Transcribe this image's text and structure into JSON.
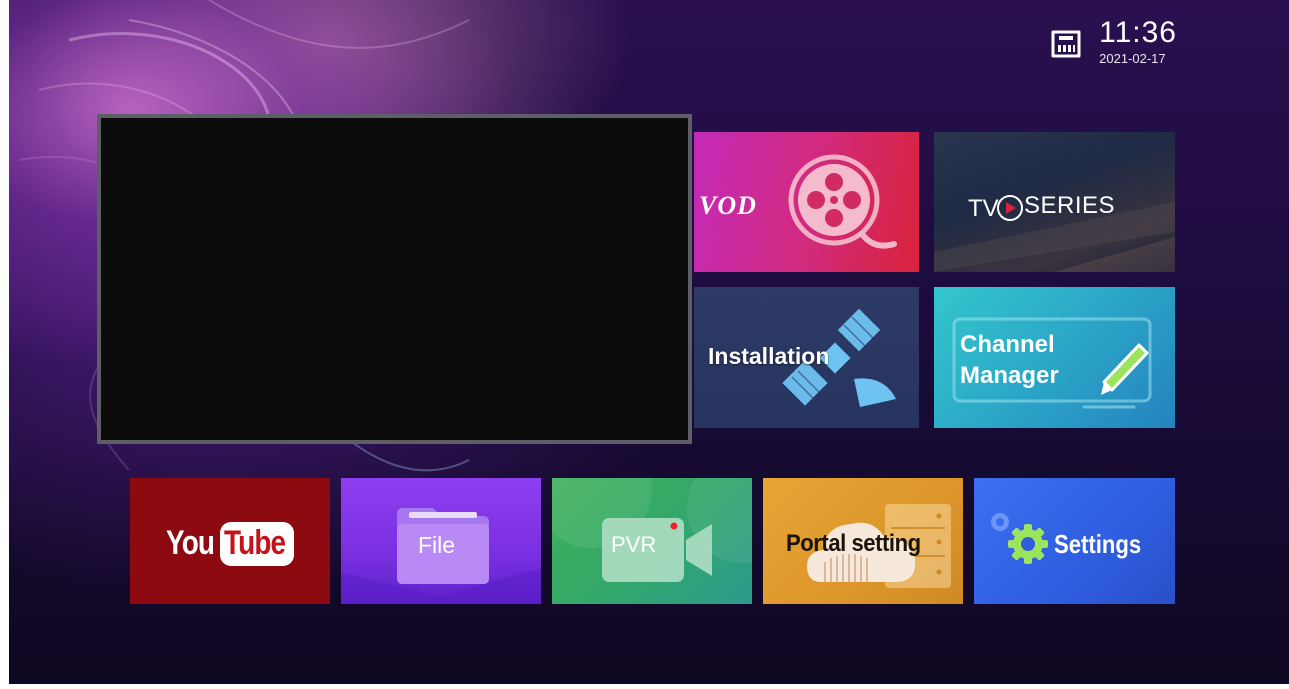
{
  "status": {
    "network_icon": "ethernet-icon",
    "time": "11:36",
    "date": "2021-02-17"
  },
  "preview": {
    "state": "no-signal"
  },
  "tiles": {
    "vod": {
      "label": "VOD",
      "icon": "film-reel-icon"
    },
    "tv_series": {
      "label_prefix": "TV",
      "label": "SERIES",
      "icon": "play-circle-icon"
    },
    "installation": {
      "label": "Installation",
      "icon": "satellite-icon"
    },
    "channel_manager": {
      "line1": "Channel",
      "line2": "Manager",
      "icon": "pencil-icon"
    },
    "youtube": {
      "label_you": "You",
      "label_tube": "Tube"
    },
    "file": {
      "label": "File",
      "icon": "folder-icon"
    },
    "pvr": {
      "label": "PVR",
      "icon": "video-camera-icon"
    },
    "portal_setting": {
      "label": "Portal setting",
      "icon": "cloud-server-icon"
    },
    "settings": {
      "label": "Settings",
      "icon": "gear-icon"
    }
  },
  "colors": {
    "vod": "#d22a7a",
    "tv_series": "#1f2a44",
    "installation": "#2e3a66",
    "channel_manager": "#2aa3c7",
    "youtube": "#8d0b10",
    "file": "#7a30e2",
    "pvr": "#34a86a",
    "portal_setting": "#dc962a",
    "settings": "#2f5ee0",
    "tv_series_play": "#d8233a"
  }
}
